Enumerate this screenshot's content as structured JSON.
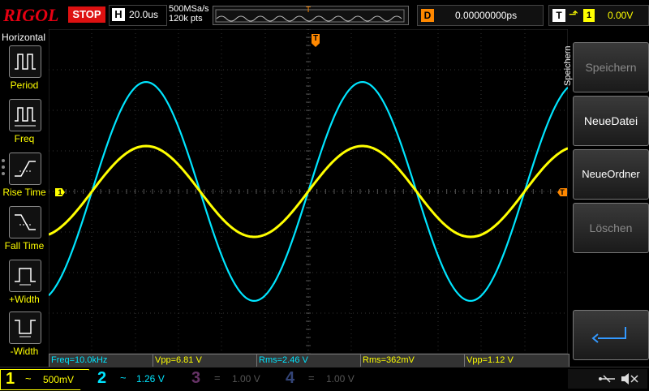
{
  "topbar": {
    "brand": "RIGOL",
    "run_status": "STOP",
    "horizontal_label": "H",
    "timebase": "20.0us",
    "sample_rate": "500MSa/s",
    "memory_depth": "120k pts",
    "trigger_marker": "T",
    "delay_label": "D",
    "delay_value": "0.00000000ps",
    "trigger_label": "T",
    "trigger_source": "1",
    "trigger_level": "0.00V"
  },
  "left_menu": {
    "title": "Horizontal",
    "items": [
      {
        "label": "Period"
      },
      {
        "label": "Freq"
      },
      {
        "label": "Rise Time"
      },
      {
        "label": "Fall Time"
      },
      {
        "label": "+Width"
      },
      {
        "label": "-Width"
      }
    ]
  },
  "right_menu": {
    "title": "Speichern",
    "buttons": [
      {
        "label": "Speichern",
        "enabled": false
      },
      {
        "label": "NeueDatei",
        "enabled": true
      },
      {
        "label": "NeueOrdner",
        "enabled": true
      },
      {
        "label": "Löschen",
        "enabled": false
      }
    ]
  },
  "screen": {
    "ch1_marker": "1",
    "trigger_level_marker": "T",
    "trigger_position_marker": "T"
  },
  "measurements": [
    {
      "text": "Freq=10.0kHz",
      "color": "#00e5ff"
    },
    {
      "text": "Vpp=6.81 V",
      "color": "#ffff00"
    },
    {
      "text": "Rms=2.46 V",
      "color": "#00e5ff"
    },
    {
      "text": "Rms=362mV",
      "color": "#ffff00"
    },
    {
      "text": "Vpp=1.12 V",
      "color": "#ffff00"
    }
  ],
  "channels": [
    {
      "num": "1",
      "coupling": "~",
      "scale": "500mV",
      "color": "#ffff00",
      "active": true
    },
    {
      "num": "2",
      "coupling": "~",
      "scale": "1.26 V",
      "color": "#00e5ff",
      "active": true
    },
    {
      "num": "3",
      "coupling": "=",
      "scale": "1.00 V",
      "color": "#cc00cc",
      "active": false
    },
    {
      "num": "4",
      "coupling": "=",
      "scale": "1.00 V",
      "color": "#3366ff",
      "active": false
    }
  ],
  "status_icons": [
    "usb-icon",
    "speaker-muted-icon"
  ],
  "colors": {
    "ch1": "#ffff00",
    "ch2": "#00e5ff",
    "trigger": "#ff8800",
    "stop": "#dd1111"
  },
  "waveforms": {
    "ch1": {
      "amplitude_v": 0.56,
      "offset_v": 0,
      "frequency_hz": 10000
    },
    "ch2": {
      "amplitude_v": 3.4,
      "offset_v": 0,
      "frequency_hz": 10000
    }
  }
}
